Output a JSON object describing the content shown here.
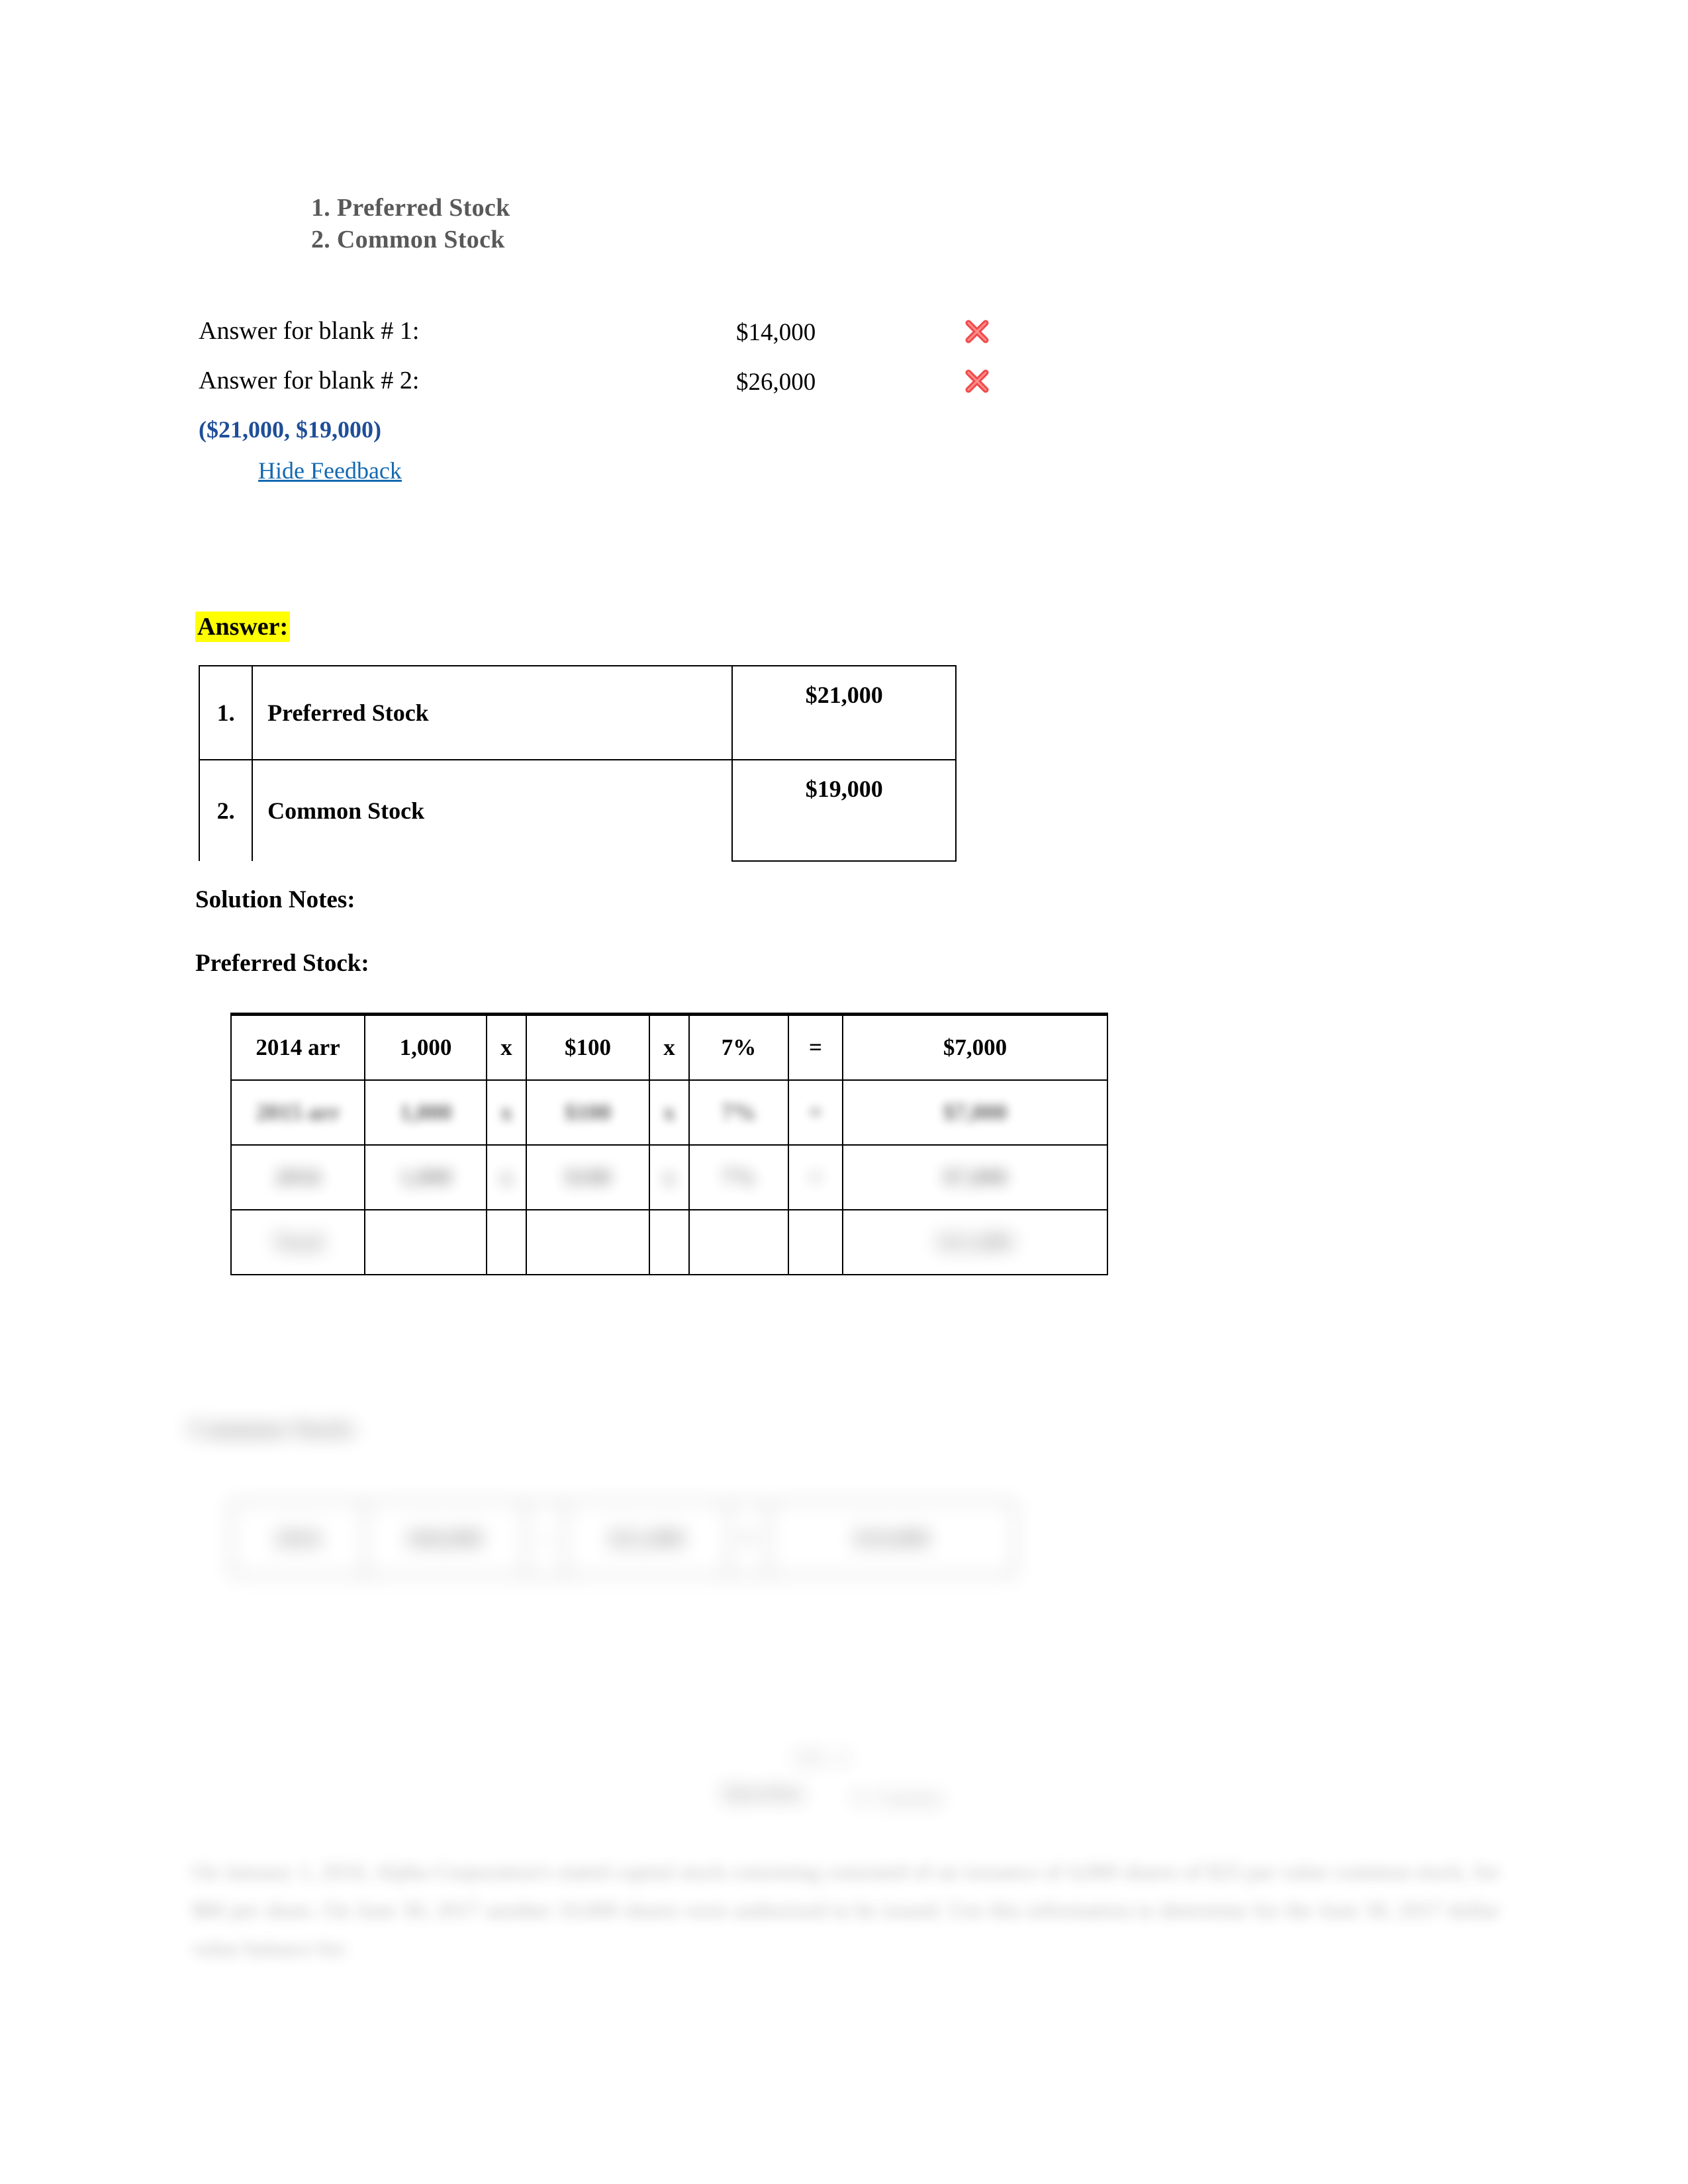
{
  "prompt": {
    "items": [
      "1. Preferred Stock",
      "2. Common Stock"
    ]
  },
  "answers": {
    "rows": [
      {
        "label": "Answer for blank # 1:",
        "value": "$14,000",
        "status_icon": "red-x-icon"
      },
      {
        "label": "Answer for blank # 2:",
        "value": "$26,000",
        "status_icon": "red-x-icon"
      }
    ],
    "correct_answer": "($21,000, $19,000)",
    "hide_feedback_link": "Hide Feedback",
    "correct_answer_color": "#1f4e99",
    "link_color": "#1569b0",
    "incorrect_icon_color": "#f04a4a"
  },
  "answer_section": {
    "heading": "Answer:",
    "highlight_color": "#ffff00",
    "table": {
      "rows": [
        {
          "num": "1.",
          "name": "Preferred Stock",
          "amount": "$21,000"
        },
        {
          "num": "2.",
          "name": "Common Stock",
          "amount": "$19,000"
        }
      ]
    }
  },
  "solution": {
    "notes_heading": "Solution Notes:",
    "preferred_heading": "Preferred Stock:",
    "common_heading": "Common Stock:",
    "preferred_table": {
      "rows": [
        {
          "label": "2014 arr",
          "qty": "1,000",
          "op1": "x",
          "par": "$100",
          "op2": "x",
          "rate": "7%",
          "eq": "=",
          "total": "$7,000"
        },
        {
          "label": "2015 arr",
          "qty": "1,000",
          "op1": "x",
          "par": "$100",
          "op2": "x",
          "rate": "7%",
          "eq": "=",
          "total": "$7,000"
        },
        {
          "label": "2016",
          "qty": "1,000",
          "op1": "x",
          "par": "$100",
          "op2": "x",
          "rate": "7%",
          "eq": "=",
          "total": "$7,000"
        },
        {
          "label": "Total",
          "qty": "",
          "op1": "",
          "par": "",
          "op2": "",
          "rate": "",
          "eq": "",
          "total": "$21,000"
        }
      ]
    },
    "common_table": {
      "rows": [
        {
          "label": "2016",
          "amount": "$40,000",
          "op": "-",
          "less": "$21,000",
          "eq": "=",
          "total": "$19,000"
        }
      ]
    }
  },
  "next_question": {
    "page_marker": "CH - 2",
    "label": "Question",
    "points": "6 / 6 points",
    "body": "On January 1, 2016, Alpha Corporation's stated capital stock consisting consisted of an issuance of 4,000 shares of $25 par value common stock, for $80 per share. On June 30, 2017 another 10,000 shares were authorized to be issued. Use this information to determine for the June 30, 2017 dollar value balance for:"
  }
}
